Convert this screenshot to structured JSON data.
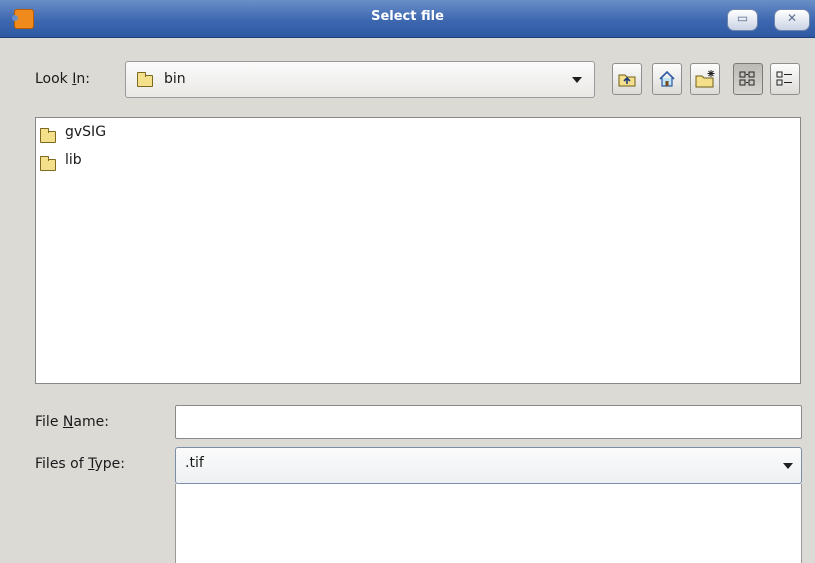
{
  "window": {
    "title": "Select file"
  },
  "look_in": {
    "label_pre": "Look ",
    "label_mnemonic": "I",
    "label_post": "n:",
    "value": "bin"
  },
  "toolbar": [
    {
      "name": "up-one-level-button",
      "icon": "folder-up-icon"
    },
    {
      "name": "home-button",
      "icon": "home-icon"
    },
    {
      "name": "new-folder-button",
      "icon": "new-folder-icon"
    },
    {
      "name": "list-view-button",
      "icon": "list-view-icon",
      "pressed": true
    },
    {
      "name": "details-view-button",
      "icon": "details-view-icon"
    }
  ],
  "files": [
    {
      "name": "gvSIG",
      "type": "folder"
    },
    {
      "name": "lib",
      "type": "folder"
    }
  ],
  "file_name": {
    "label_pre": "File ",
    "label_mnemonic": "N",
    "label_post": "ame:",
    "value": "",
    "placeholder": ""
  },
  "file_type": {
    "label_pre": "Files of ",
    "label_mnemonic": "T",
    "label_post": "ype:",
    "value": ".tif"
  },
  "colors": {
    "titlebar": "#3d68b0",
    "dialog_bg": "#dcdad5",
    "folder": "#f4e08a"
  }
}
